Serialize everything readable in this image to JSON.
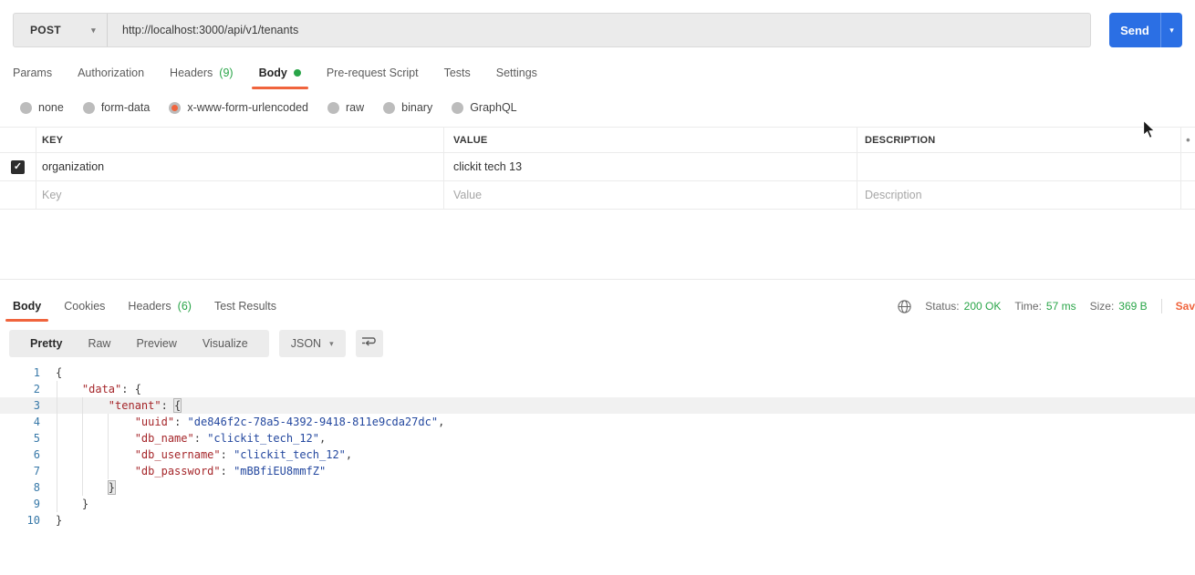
{
  "icons": {
    "chevron_down": "▾",
    "check": "✓",
    "bullet": "•"
  },
  "colors": {
    "accent_orange": "#F0643D",
    "status_green": "#29A548",
    "send_blue": "#2B6FE4",
    "json_key": "#A5262A",
    "json_string": "#24489F"
  },
  "request": {
    "method": "POST",
    "url": "http://localhost:3000/api/v1/tenants",
    "send_label": "Send",
    "tabs": [
      {
        "label": "Params"
      },
      {
        "label": "Authorization"
      },
      {
        "label": "Headers",
        "count": "(9)"
      },
      {
        "label": "Body",
        "active": true,
        "dot": true
      },
      {
        "label": "Pre-request Script"
      },
      {
        "label": "Tests"
      },
      {
        "label": "Settings"
      }
    ],
    "body_modes": [
      {
        "label": "none"
      },
      {
        "label": "form-data"
      },
      {
        "label": "x-www-form-urlencoded",
        "selected": true
      },
      {
        "label": "raw"
      },
      {
        "label": "binary"
      },
      {
        "label": "GraphQL"
      }
    ],
    "table": {
      "col_key": "KEY",
      "col_value": "VALUE",
      "col_description": "DESCRIPTION",
      "rows": [
        {
          "checked": true,
          "key": "organization",
          "value": "clickit tech 13",
          "description": ""
        }
      ],
      "placeholder_row": {
        "key": "Key",
        "value": "Value",
        "description": "Description"
      }
    }
  },
  "response": {
    "tabs": [
      {
        "label": "Body",
        "active": true
      },
      {
        "label": "Cookies"
      },
      {
        "label": "Headers",
        "count": "(6)"
      },
      {
        "label": "Test Results"
      }
    ],
    "meta": {
      "status_label": "Status:",
      "status_value": "200 OK",
      "time_label": "Time:",
      "time_value": "57 ms",
      "size_label": "Size:",
      "size_value": "369 B",
      "save_label": "Sav"
    },
    "toolbar": {
      "views": [
        "Pretty",
        "Raw",
        "Preview",
        "Visualize"
      ],
      "active_view": "Pretty",
      "language": "JSON"
    },
    "code": {
      "lines": [
        {
          "n": 1,
          "tokens": [
            {
              "t": "{",
              "c": "p"
            }
          ]
        },
        {
          "n": 2,
          "tokens": [
            {
              "t": "    ",
              "c": "p"
            },
            {
              "t": "\"data\"",
              "c": "k"
            },
            {
              "t": ": ",
              "c": "p"
            },
            {
              "t": "{",
              "c": "p"
            }
          ]
        },
        {
          "n": 3,
          "hl": true,
          "tokens": [
            {
              "t": "        ",
              "c": "p"
            },
            {
              "t": "\"tenant\"",
              "c": "k"
            },
            {
              "t": ": ",
              "c": "p"
            },
            {
              "t": "{",
              "c": "p",
              "box": true
            }
          ]
        },
        {
          "n": 4,
          "tokens": [
            {
              "t": "            ",
              "c": "p"
            },
            {
              "t": "\"uuid\"",
              "c": "k"
            },
            {
              "t": ": ",
              "c": "p"
            },
            {
              "t": "\"de846f2c-78a5-4392-9418-811e9cda27dc\"",
              "c": "v"
            },
            {
              "t": ",",
              "c": "p"
            }
          ]
        },
        {
          "n": 5,
          "tokens": [
            {
              "t": "            ",
              "c": "p"
            },
            {
              "t": "\"db_name\"",
              "c": "k"
            },
            {
              "t": ": ",
              "c": "p"
            },
            {
              "t": "\"clickit_tech_12\"",
              "c": "v"
            },
            {
              "t": ",",
              "c": "p"
            }
          ]
        },
        {
          "n": 6,
          "tokens": [
            {
              "t": "            ",
              "c": "p"
            },
            {
              "t": "\"db_username\"",
              "c": "k"
            },
            {
              "t": ": ",
              "c": "p"
            },
            {
              "t": "\"clickit_tech_12\"",
              "c": "v"
            },
            {
              "t": ",",
              "c": "p"
            }
          ]
        },
        {
          "n": 7,
          "tokens": [
            {
              "t": "            ",
              "c": "p"
            },
            {
              "t": "\"db_password\"",
              "c": "k"
            },
            {
              "t": ": ",
              "c": "p"
            },
            {
              "t": "\"mBBfiEU8mmfZ\"",
              "c": "v"
            }
          ]
        },
        {
          "n": 8,
          "tokens": [
            {
              "t": "        ",
              "c": "p"
            },
            {
              "t": "}",
              "c": "p",
              "box": true
            }
          ]
        },
        {
          "n": 9,
          "tokens": [
            {
              "t": "    ",
              "c": "p"
            },
            {
              "t": "}",
              "c": "p"
            }
          ]
        },
        {
          "n": 10,
          "tokens": [
            {
              "t": "}",
              "c": "p"
            }
          ]
        }
      ]
    }
  }
}
